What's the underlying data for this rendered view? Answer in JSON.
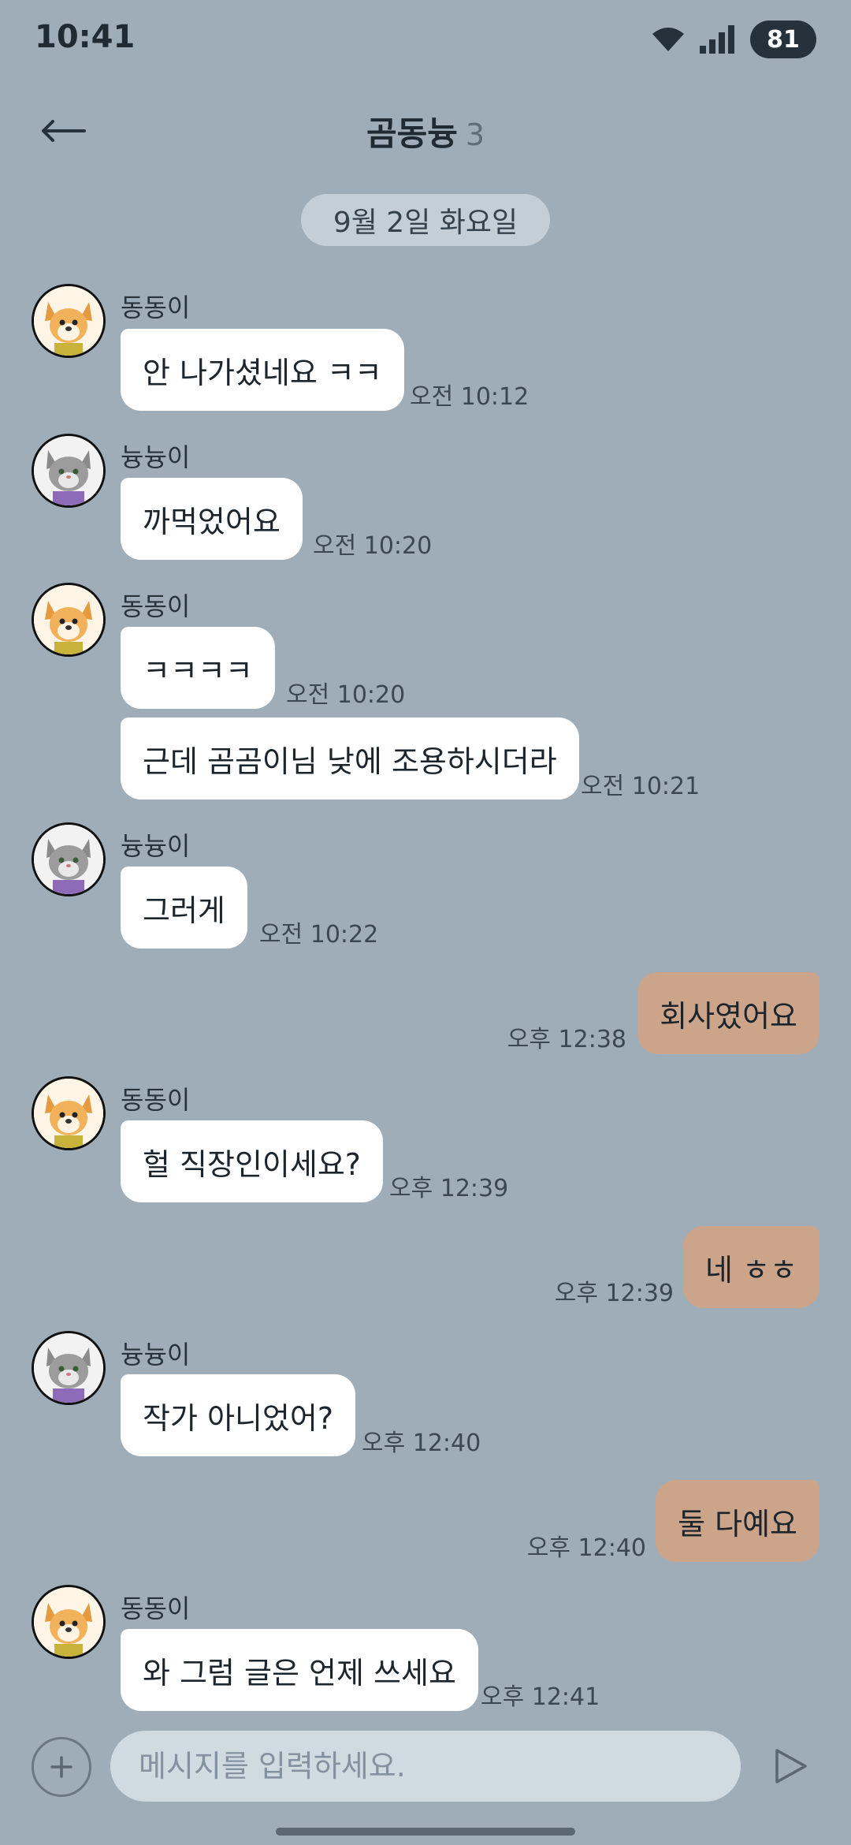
{
  "status": {
    "time": "10:41",
    "battery": "81"
  },
  "header": {
    "title": "곰동늉",
    "member_count": "3"
  },
  "date_divider": "9월 2일 화요일",
  "messages": [
    {
      "sender": "동동이",
      "avatar": "dog-avatar",
      "direction": "in",
      "text": "안 나가셨네요 ㅋㅋ",
      "time": "오전 10:12"
    },
    {
      "sender": "늉늉이",
      "avatar": "cat-avatar",
      "direction": "in",
      "text": "까먹었어요",
      "time": "오전 10:20"
    },
    {
      "sender": "동동이",
      "avatar": "dog-avatar",
      "direction": "in",
      "text": "ㅋㅋㅋㅋ",
      "time": "오전 10:20"
    },
    {
      "sender": "",
      "avatar": "",
      "direction": "in",
      "text": "근데 곰곰이님 낮에 조용하시더라",
      "time": "오전 10:21"
    },
    {
      "sender": "늉늉이",
      "avatar": "cat-avatar",
      "direction": "in",
      "text": "그러게",
      "time": "오전 10:22"
    },
    {
      "sender": "",
      "avatar": "",
      "direction": "out",
      "text": "회사였어요",
      "time": "오후 12:38"
    },
    {
      "sender": "동동이",
      "avatar": "dog-avatar",
      "direction": "in",
      "text": "헐 직장인이세요?",
      "time": "오후 12:39"
    },
    {
      "sender": "",
      "avatar": "",
      "direction": "out",
      "text": "네 ㅎㅎ",
      "time": "오후 12:39"
    },
    {
      "sender": "늉늉이",
      "avatar": "cat-avatar",
      "direction": "in",
      "text": "작가 아니었어?",
      "time": "오후 12:40"
    },
    {
      "sender": "",
      "avatar": "",
      "direction": "out",
      "text": "둘 다예요",
      "time": "오후 12:40"
    },
    {
      "sender": "동동이",
      "avatar": "dog-avatar",
      "direction": "in",
      "text": "와 그럼 글은 언제 쓰세요",
      "time": "오후 12:41"
    }
  ],
  "input": {
    "placeholder": "메시지를 입력하세요.",
    "value": ""
  },
  "icons": {
    "back": "back-arrow-icon",
    "add": "plus-icon",
    "send": "send-icon",
    "wifi": "wifi-icon",
    "signal": "signal-icon"
  },
  "colors": {
    "background": "#9eadb8",
    "incoming_bubble": "#ffffff",
    "outgoing_bubble": "#cba48a",
    "date_chip": "#c3ced6",
    "input_field": "#d0dae1"
  }
}
